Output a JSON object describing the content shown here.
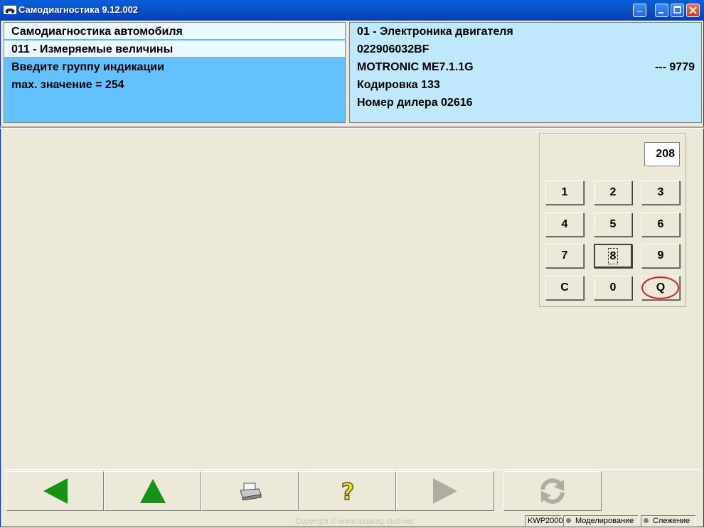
{
  "window": {
    "title": "Самодиагностика 9.12.002"
  },
  "left_panel": {
    "line1": "Самодиагностика автомобиля",
    "line2": "011 - Измеряемые величины",
    "line3": "Введите группу индикации",
    "line4": "max. значение = 254"
  },
  "right_panel": {
    "line1": "01 - Электроника двигателя",
    "line2": "022906032BF",
    "line3": "MOTRONIC ME7.1.1G",
    "line3_right": "---  9779",
    "line4": "Кодировка 133",
    "line5": "Номер дилера 02616"
  },
  "keypad": {
    "display_value": "208",
    "keys": [
      "1",
      "2",
      "3",
      "4",
      "5",
      "6",
      "7",
      "8",
      "9",
      "C",
      "0",
      "Q"
    ]
  },
  "toolbar": {
    "icons": [
      "arrow-left-icon",
      "arrow-up-icon",
      "printer-icon",
      "help-icon",
      "arrow-right-icon",
      "refresh-icon"
    ],
    "colors": {
      "active_arrow": "#169216",
      "disabled": "#b0ada0",
      "help": "#f0e010"
    }
  },
  "statusbar": {
    "protocol": "KWP2000",
    "mode1": "Моделирование",
    "mode2": "Слежение"
  },
  "footer": {
    "copyright": "Copyright © www.touareg-club.net"
  }
}
